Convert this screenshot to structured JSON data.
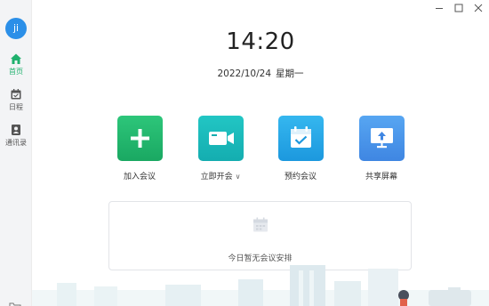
{
  "window_controls": {
    "icons": [
      "minimize-icon",
      "maximize-icon",
      "close-icon"
    ]
  },
  "sidebar": {
    "avatar_text": "ji",
    "items": [
      {
        "label": "首页",
        "icon": "home-icon",
        "active": true
      },
      {
        "label": "日程",
        "icon": "calendar-icon",
        "active": false
      },
      {
        "label": "通讯录",
        "icon": "contacts-icon",
        "active": false
      }
    ],
    "bottom_icon": "folder-icon"
  },
  "main": {
    "time": "14:20",
    "date": "2022/10/24",
    "weekday": "星期一",
    "actions": [
      {
        "label": "加入会议",
        "icon": "plus-icon",
        "color": "#1fb16d"
      },
      {
        "label": "立即开会",
        "icon": "video-camera-icon",
        "color": "#14adb0",
        "dropdown": true
      },
      {
        "label": "预约会议",
        "icon": "calendar-check-icon",
        "color": "#1c98de"
      },
      {
        "label": "共享屏幕",
        "icon": "screen-share-icon",
        "color": "#3f86e2"
      }
    ],
    "agenda_empty_text": "今日暂无会议安排"
  },
  "colors": {
    "accent_green": "#1fb16d",
    "avatar_blue": "#2b8fe8",
    "sidebar_bg": "#f3f4f6"
  }
}
